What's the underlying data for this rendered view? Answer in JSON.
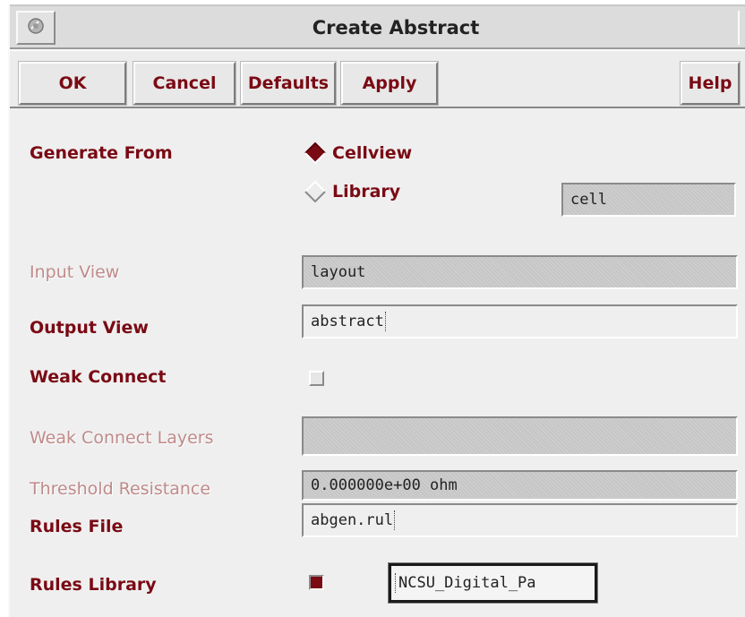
{
  "window": {
    "title": "Create Abstract",
    "system_menu_icon": "motif-window-menu-icon"
  },
  "buttons": {
    "ok": "OK",
    "cancel": "Cancel",
    "defaults": "Defaults",
    "apply": "Apply",
    "help": "Help"
  },
  "form": {
    "generate_from": {
      "label": "Generate From",
      "options": [
        "Cellview",
        "Library"
      ],
      "selected": "Cellview",
      "cell_value": "cell"
    },
    "input_view": {
      "label": "Input View",
      "value": "layout",
      "enabled": false
    },
    "output_view": {
      "label": "Output View",
      "value": "abstract"
    },
    "weak_connect": {
      "label": "Weak Connect",
      "checked": false
    },
    "weak_connect_layers": {
      "label": "Weak Connect Layers",
      "value": "",
      "enabled": false
    },
    "threshold_resistance": {
      "label": "Threshold Resistance",
      "value": "0.000000e+00 ohm",
      "enabled": false
    },
    "rules_file": {
      "label": "Rules File",
      "value": "abgen.rul"
    },
    "rules_library": {
      "label": "Rules Library",
      "checked": true,
      "value": "NCSU_Digital_Pa"
    }
  },
  "colors": {
    "label": "#7a0a14",
    "disabled_label": "#c08a8a",
    "background": "#efefef",
    "readonly_field": "#c6c6c6"
  }
}
